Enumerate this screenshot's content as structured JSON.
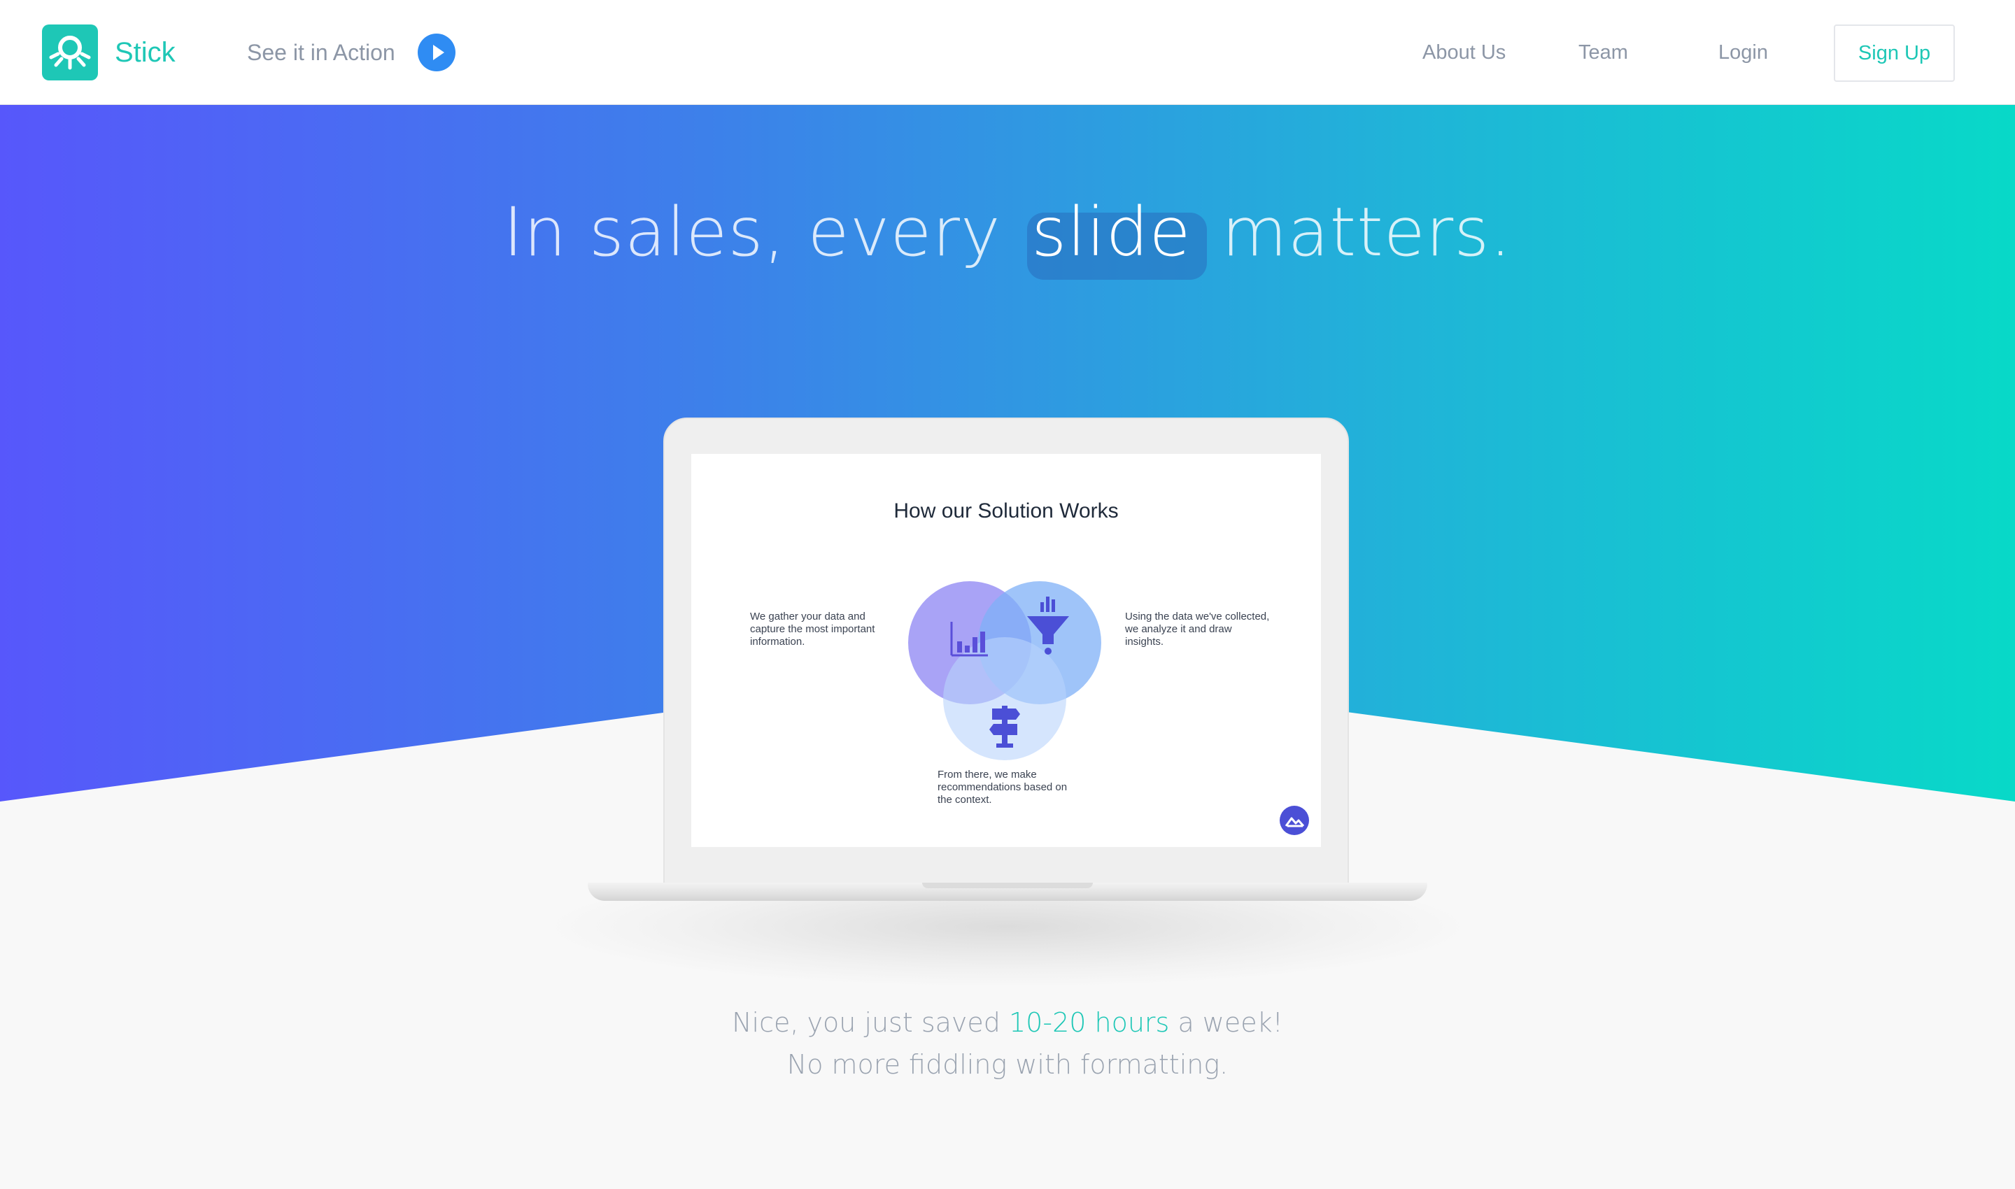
{
  "nav": {
    "brand": "Stick",
    "see_action": "See it in Action",
    "links": {
      "about": "About Us",
      "team": "Team",
      "login": "Login"
    },
    "signup": "Sign Up"
  },
  "hero": {
    "headline_before": "In sales, every",
    "headline_highlight": "slide",
    "headline_after": "matters."
  },
  "slide": {
    "title": "How our Solution Works",
    "text_left": "We gather your data and capture the most important information.",
    "text_right": "Using the data we've collected, we analyze it and draw insights.",
    "text_bottom": "From there, we make recommendations based on the context."
  },
  "tagline": {
    "line1_before": "Nice, you just saved",
    "line1_accent": "10-20 hours",
    "line1_after": "a week!",
    "line2": "No more fiddling with formatting."
  },
  "colors": {
    "brand": "#1ec7b6",
    "play_button": "#2f8cf3",
    "gradient_left": "#5757fb",
    "gradient_right": "#08d9c8",
    "muted_text": "#8c96a6"
  },
  "icons": [
    "stick-logo-icon",
    "play-icon",
    "bar-chart-icon",
    "funnel-icon",
    "signpost-icon",
    "mountain-logo-icon"
  ]
}
